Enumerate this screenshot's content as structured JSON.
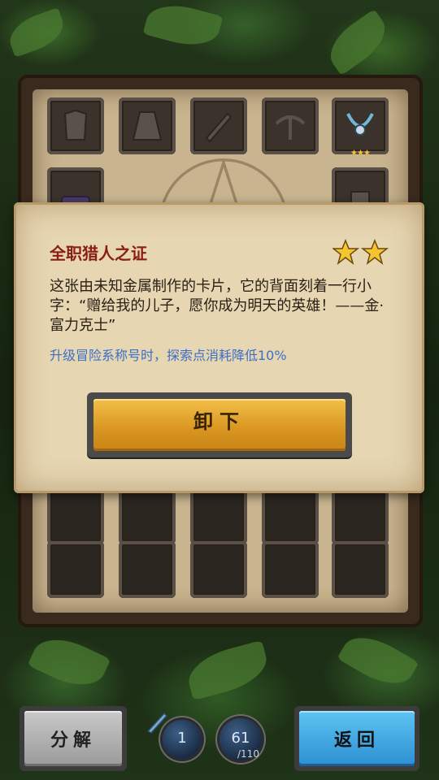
{
  "inventory": {
    "top_slot_stars": "★★★"
  },
  "dialog": {
    "title": "全职猎人之证",
    "star_count": 2,
    "description": "这张由未知金属制作的卡片，它的背面刻着一行小字：“赠给我的儿子，愿你成为明天的英雄！——金·富力克士”",
    "effect": "升级冒险系称号时，探索点消耗降低10%",
    "unequip_label": "卸下"
  },
  "bottom_bar": {
    "split_label": "分解",
    "back_label": "返回",
    "orb_left_value": "1",
    "orb_right_value": "61",
    "orb_right_max": "/110"
  },
  "colors": {
    "title_red": "#8a1e12",
    "effect_blue": "#3d6fc6",
    "gold_button": "#d8951f",
    "blue_button": "#2c8fd2"
  }
}
